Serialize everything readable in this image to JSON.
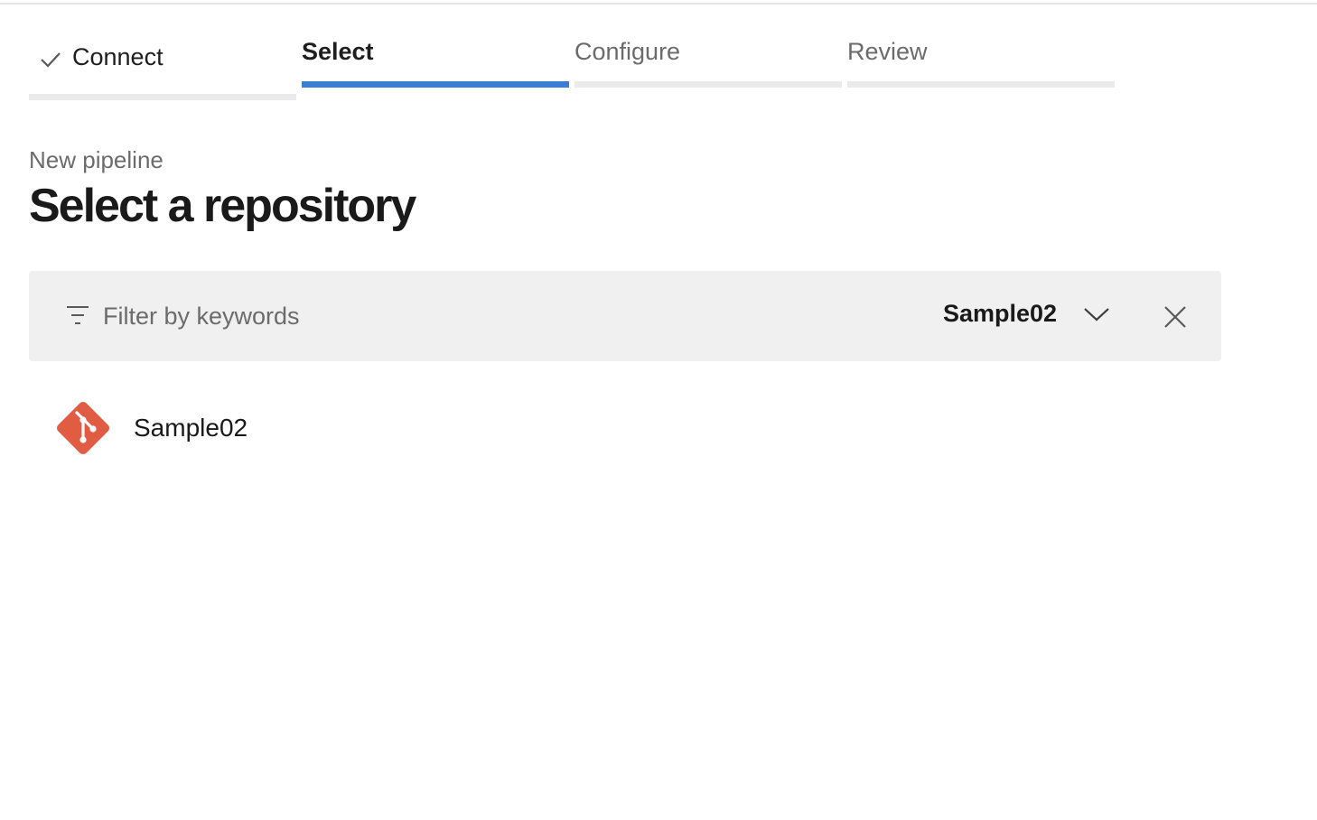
{
  "wizard": {
    "steps": [
      {
        "label": "Connect",
        "state": "done"
      },
      {
        "label": "Select",
        "state": "active"
      },
      {
        "label": "Configure",
        "state": "pending"
      },
      {
        "label": "Review",
        "state": "pending"
      }
    ]
  },
  "header": {
    "subtitle": "New pipeline",
    "title": "Select a repository"
  },
  "filter": {
    "placeholder": "Filter by keywords",
    "value": "",
    "selected_project": "Sample02",
    "icons": [
      "filter-icon",
      "chevron-down-icon",
      "close-icon"
    ]
  },
  "repositories": [
    {
      "name": "Sample02",
      "icon": "git-icon"
    }
  ],
  "colors": {
    "accent": "#3a7fd5",
    "git": "#e05d44",
    "filter_bg": "#f0f0f0",
    "inactive_bar": "#eaeaea"
  }
}
